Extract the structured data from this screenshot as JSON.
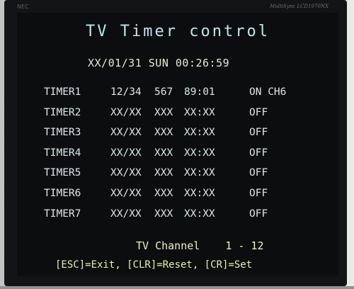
{
  "monitor": {
    "brand_left": "NEC",
    "brand_right": "MultiSync LCD1970NX"
  },
  "screen": {
    "title": "TV Timer control",
    "datetime": "XX/01/31 SUN 00:26:59",
    "timers": [
      {
        "name": "TIMER1",
        "date": "12/34",
        "num": "567",
        "time": "89:01",
        "state": "ON CH6"
      },
      {
        "name": "TIMER2",
        "date": "XX/XX",
        "num": "XXX",
        "time": "XX:XX",
        "state": "OFF"
      },
      {
        "name": "TIMER3",
        "date": "XX/XX",
        "num": "XXX",
        "time": "XX:XX",
        "state": "OFF"
      },
      {
        "name": "TIMER4",
        "date": "XX/XX",
        "num": "XXX",
        "time": "XX:XX",
        "state": "OFF"
      },
      {
        "name": "TIMER5",
        "date": "XX/XX",
        "num": "XXX",
        "time": "XX:XX",
        "state": "OFF"
      },
      {
        "name": "TIMER6",
        "date": "XX/XX",
        "num": "XXX",
        "time": "XX:XX",
        "state": "OFF"
      },
      {
        "name": "TIMER7",
        "date": "XX/XX",
        "num": "XXX",
        "time": "XX:XX",
        "state": "OFF"
      }
    ],
    "channel_label": "TV Channel",
    "channel_range": "1 - 12",
    "key_help": "[ESC]=Exit, [CLR]=Reset, [CR]=Set"
  },
  "colors": {
    "screen_bg": "#0c0d0e",
    "text_cyan": "#bfe6ee",
    "text_yellow": "#e4f0b0"
  }
}
